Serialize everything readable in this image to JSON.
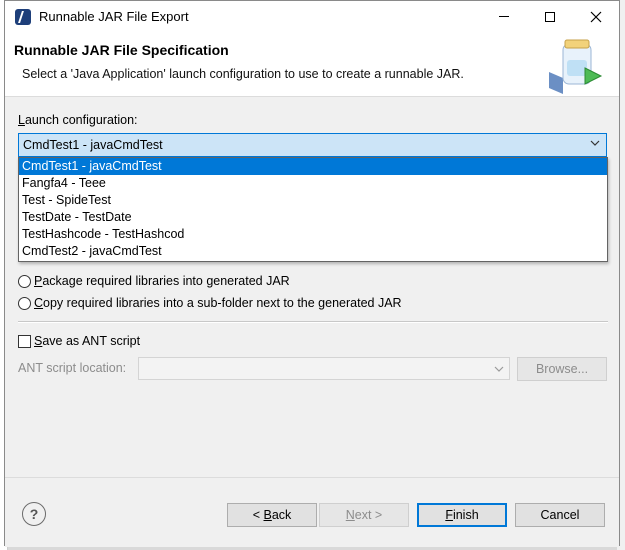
{
  "window": {
    "title": "Runnable JAR File Export"
  },
  "header": {
    "title": "Runnable JAR File Specification",
    "description": "Select a 'Java Application' launch configuration to use to create a runnable JAR."
  },
  "launch": {
    "label_mnemonic": "L",
    "label_rest": "aunch configuration:",
    "selected": "CmdTest1 - javaCmdTest",
    "options": [
      "CmdTest1 - javaCmdTest",
      "Fangfa4 - Teee",
      "Test - SpideTest",
      "TestDate - TestDate",
      "TestHashcode - TestHashcod",
      "CmdTest2 - javaCmdTest"
    ]
  },
  "library_handling": {
    "package_mnemonic": "P",
    "package_rest": "ackage required libraries into generated JAR",
    "copy_mnemonic": "C",
    "copy_rest": "opy required libraries into a sub-folder next to the generated JAR"
  },
  "ant": {
    "save_mnemonic": "S",
    "save_rest": "ave as ANT script",
    "location_label": "ANT script location:",
    "browse_label": "Browse..."
  },
  "buttons": {
    "help": "?",
    "back_prefix": "< ",
    "back_mnemonic": "B",
    "back_rest": "ack",
    "next_mnemonic": "N",
    "next_rest": "ext >",
    "finish_mnemonic": "F",
    "finish_rest": "inish",
    "cancel": "Cancel"
  },
  "colors": {
    "accent": "#0078d7",
    "selection_bg": "#cce4f7"
  }
}
